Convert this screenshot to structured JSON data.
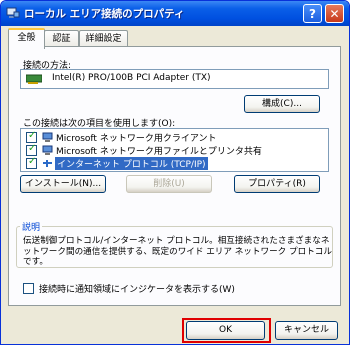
{
  "window": {
    "title": "ローカル エリア接続のプロパティ",
    "help_label": "?",
    "close_label": "✕"
  },
  "tabs": [
    {
      "label": "全般"
    },
    {
      "label": "認証"
    },
    {
      "label": "詳細設定"
    }
  ],
  "connect_using": {
    "label": "接続の方法:",
    "adapter": "Intel(R) PRO/100B PCI Adapter (TX)",
    "configure_label": "構成(C)..."
  },
  "items_section": {
    "label": "この接続は次の項目を使用します(O):",
    "items": [
      {
        "label": "Microsoft ネットワーク用クライアント",
        "checked": true
      },
      {
        "label": "Microsoft ネットワーク用ファイルとプリンタ共有",
        "checked": true
      },
      {
        "label": "インターネット プロトコル (TCP/IP)",
        "checked": true,
        "selected": true
      }
    ]
  },
  "buttons": {
    "install": "インストール(N)...",
    "uninstall": "削除(U)",
    "properties": "プロパティ(R)"
  },
  "description": {
    "title": "説明",
    "text": "伝送制御プロトコル/インターネット プロトコル。相互接続されたさまざまなネットワーク間の通信を提供する、既定のワイド エリア ネットワーク プロトコルです。"
  },
  "notify_checkbox": {
    "label": "接続時に通知領域にインジケータを表示する(W)",
    "checked": false
  },
  "footer": {
    "ok_label": "OK",
    "cancel_label": "キャンセル"
  },
  "colors": {
    "titlebar": "#0054e3",
    "highlight": "#316ac5",
    "ok_outline": "#e00000"
  }
}
